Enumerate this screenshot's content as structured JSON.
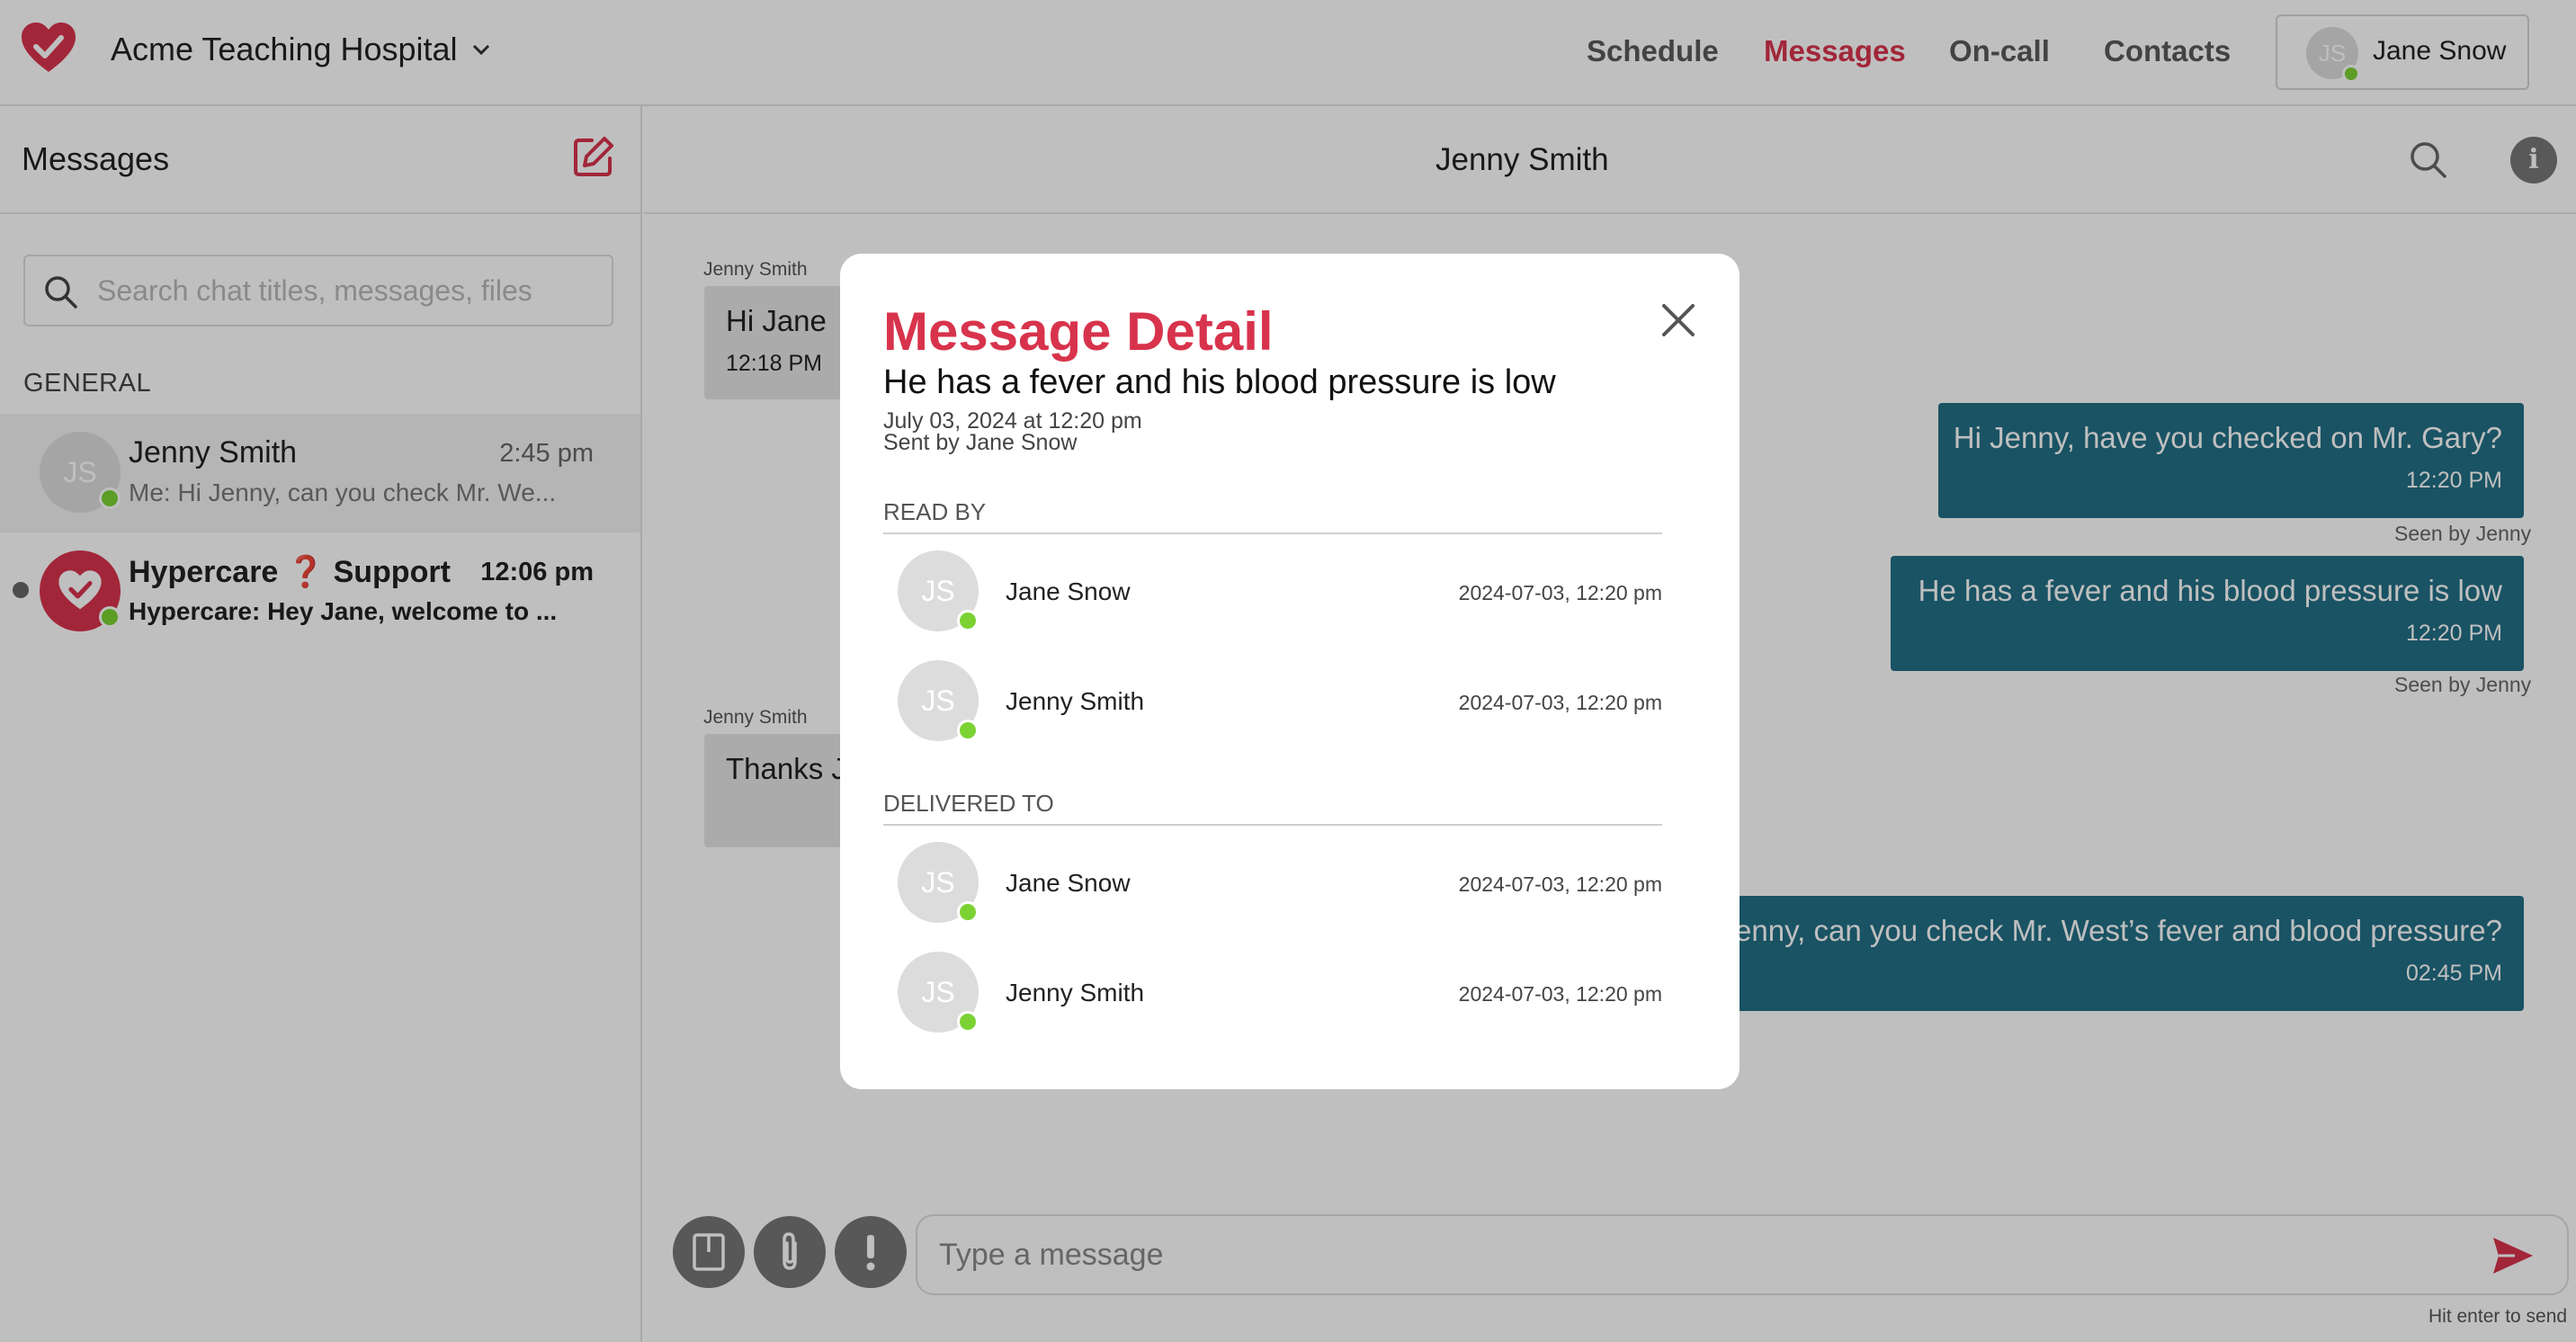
{
  "header": {
    "org_name": "Acme Teaching Hospital",
    "nav": [
      "Schedule",
      "Messages",
      "On-call",
      "Contacts"
    ],
    "active_nav": "Messages",
    "user": {
      "initials": "JS",
      "name": "Jane Snow"
    }
  },
  "sidebar": {
    "title": "Messages",
    "search_placeholder": "Search chat titles, messages, files",
    "section": "GENERAL",
    "chats": [
      {
        "initials": "JS",
        "name": "Jenny Smith",
        "time": "2:45 pm",
        "preview": "Me: Hi Jenny, can you check Mr. We..."
      },
      {
        "name_a": "Hypercare",
        "name_mark": "❓",
        "name_b": "Support",
        "time": "12:06 pm",
        "preview": "Hypercare: Hey Jane, welcome to ..."
      }
    ]
  },
  "chat": {
    "title": "Jenny Smith",
    "messages": [
      {
        "sender": "Jenny Smith",
        "text": "Hi Jane",
        "time": "12:18 PM"
      },
      {
        "text": "Hi Jenny, have you checked on Mr. Gary?",
        "time": "12:20 PM",
        "seen": "Seen by Jenny"
      },
      {
        "text": "He has a fever and his blood pressure is low",
        "time": "12:20 PM",
        "seen": "Seen by Jenny"
      },
      {
        "sender": "Jenny Smith",
        "text": "Thanks J"
      },
      {
        "text": "enny, can you check Mr. West’s fever and blood pressure?",
        "time": "02:45 PM"
      }
    ],
    "composer_placeholder": "Type a message",
    "hint": "Hit enter to send"
  },
  "modal": {
    "title": "Message Detail",
    "message": "He has a fever and his blood pressure is low",
    "date": "July 03, 2024 at 12:20 pm",
    "sent_by": "Sent by Jane Snow",
    "read_by_label": "READ BY",
    "read_by": [
      {
        "initials": "JS",
        "name": "Jane Snow",
        "time": "2024-07-03, 12:20 pm"
      },
      {
        "initials": "JS",
        "name": "Jenny Smith",
        "time": "2024-07-03, 12:20 pm"
      }
    ],
    "delivered_label": "DELIVERED TO",
    "delivered_to": [
      {
        "initials": "JS",
        "name": "Jane Snow",
        "time": "2024-07-03, 12:20 pm"
      },
      {
        "initials": "JS",
        "name": "Jenny Smith",
        "time": "2024-07-03, 12:20 pm"
      }
    ]
  },
  "colors": {
    "brand": "#d8334c",
    "outgoing": "#226f86",
    "online": "#7bd232"
  },
  "icons": [
    "heart-check-logo-icon",
    "chevron-down-icon",
    "compose-icon",
    "search-icon",
    "info-icon",
    "close-icon",
    "note-icon",
    "paperclip-icon",
    "priority-icon",
    "send-icon"
  ]
}
